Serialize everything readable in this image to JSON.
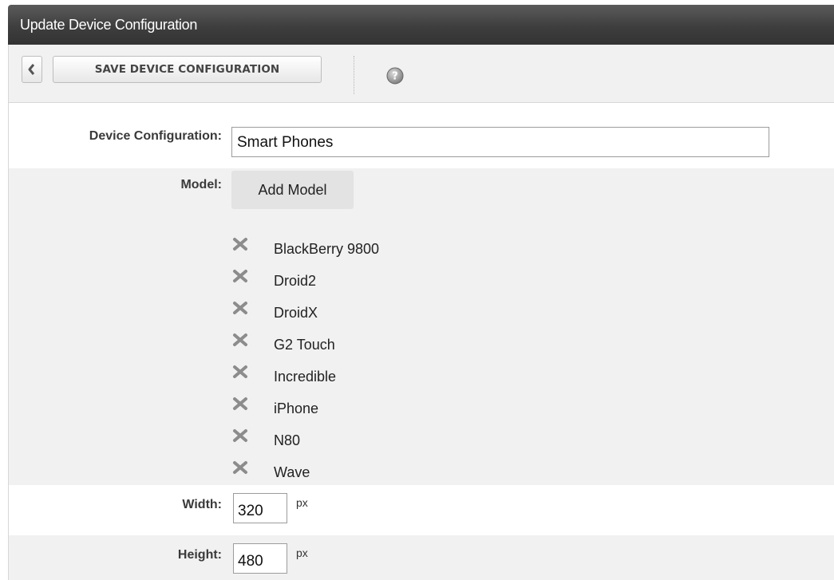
{
  "window": {
    "title": "Update Device Configuration"
  },
  "toolbar": {
    "back_icon": "chevron-left-icon",
    "save_label": "SAVE DEVICE CONFIGURATION",
    "help_icon": "help-icon"
  },
  "form": {
    "device_configuration": {
      "label": "Device Configuration:",
      "value": "Smart Phones"
    },
    "model": {
      "label": "Model:",
      "add_button": "Add Model",
      "remove_icon": "remove-x-icon",
      "items": [
        "BlackBerry 9800",
        "Droid2",
        "DroidX",
        "G2 Touch",
        "Incredible",
        "iPhone",
        "N80",
        "Wave"
      ]
    },
    "width": {
      "label": "Width:",
      "value": "320",
      "unit": "px"
    },
    "height": {
      "label": "Height:",
      "value": "480",
      "unit": "px"
    }
  },
  "colors": {
    "titlebar": "#3e3e3e",
    "toolbar_bg": "#f1f1f1",
    "shaded_row": "#f1f1f1",
    "remove_icon": "#8c8c8c"
  }
}
